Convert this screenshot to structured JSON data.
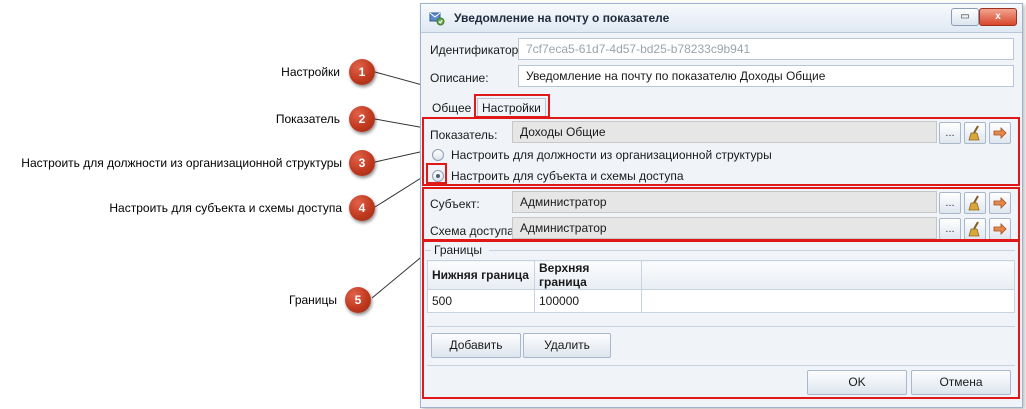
{
  "callouts": [
    {
      "number": "1",
      "label": "Настройки"
    },
    {
      "number": "2",
      "label": "Показатель"
    },
    {
      "number": "3",
      "label": "Настроить для должности из организационной структуры"
    },
    {
      "number": "4",
      "label": "Настроить для субъекта и схемы доступа"
    },
    {
      "number": "5",
      "label": "Границы"
    }
  ],
  "window": {
    "title": "Уведомление на почту о показателе",
    "buttons": {
      "restore": "▭",
      "close": "x"
    }
  },
  "form": {
    "identifier_label": "Идентификатор:",
    "identifier_value": "7cf7eca5-61d7-4d57-bd25-b78233c9b941",
    "description_label": "Описание:",
    "description_value": "Уведомление на почту по показателю Доходы Общие"
  },
  "tabs": [
    {
      "label": "Общее",
      "active": false
    },
    {
      "label": "Настройки",
      "active": true
    }
  ],
  "settings": {
    "indicator_label": "Показатель:",
    "indicator_value": "Доходы Общие",
    "radio_position": "Настроить для должности из организационной структуры",
    "radio_subject": "Настроить для субъекта и схемы доступа",
    "selected_radio": "subject",
    "subject_label": "Субъект:",
    "subject_value": "Администратор",
    "access_scheme_label": "Схема доступа:",
    "access_scheme_value": "Администратор",
    "browse_button": "...",
    "icons": {
      "clear": "broom-icon",
      "navigate": "arrow-icon"
    }
  },
  "bounds": {
    "group_label": "Границы",
    "columns": [
      "Нижняя граница",
      "Верхняя граница"
    ],
    "rows": [
      [
        "500",
        "100000"
      ]
    ],
    "add_button": "Добавить",
    "delete_button": "Удалить"
  },
  "footer": {
    "ok_button": "OK",
    "cancel_button": "Отмена"
  },
  "colors": {
    "highlight": "#e01818",
    "badge": "#c0391f"
  }
}
